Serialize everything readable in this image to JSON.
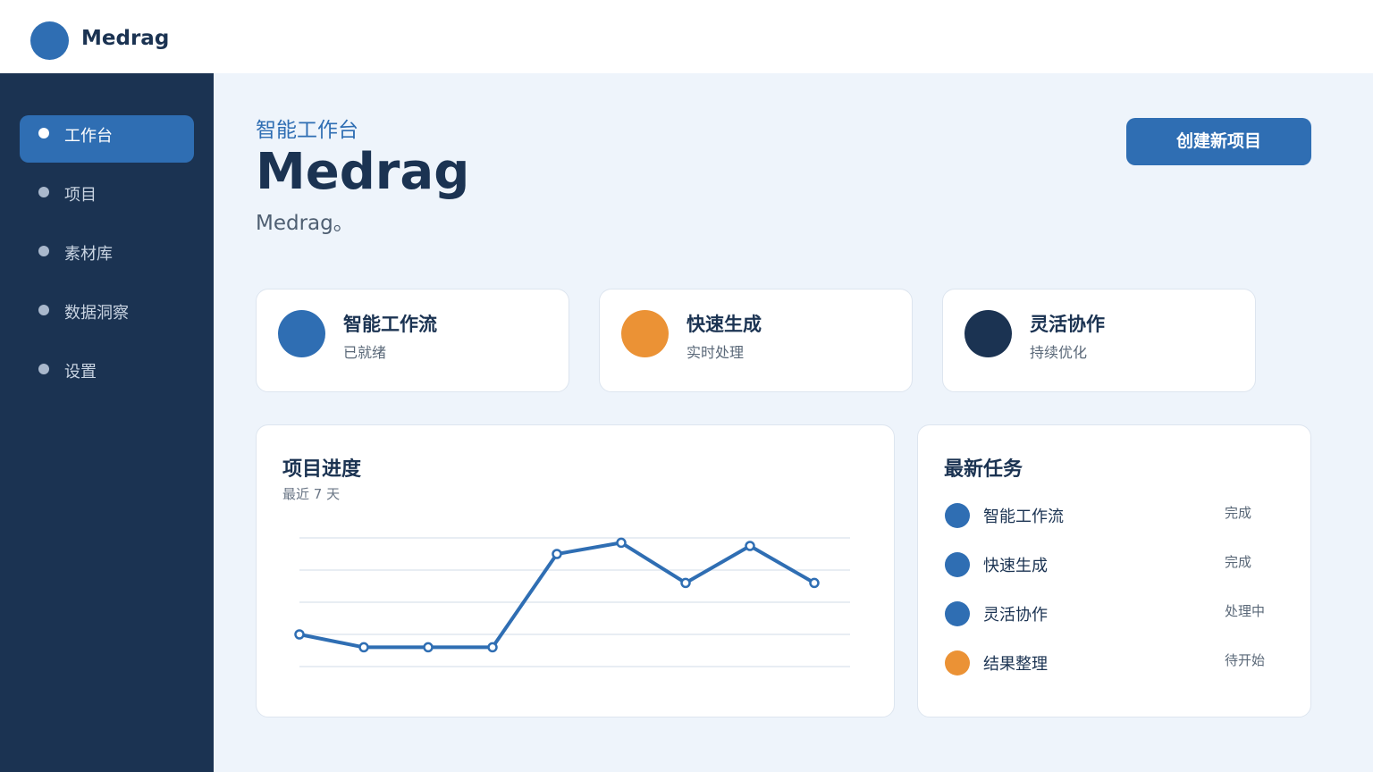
{
  "header": {
    "brand": "Medrag"
  },
  "sidebar": {
    "items": [
      {
        "label": "工作台",
        "active": true
      },
      {
        "label": "项目",
        "active": false
      },
      {
        "label": "素材库",
        "active": false
      },
      {
        "label": "数据洞察",
        "active": false
      },
      {
        "label": "设置",
        "active": false
      }
    ]
  },
  "main": {
    "subtitle": "智能工作台",
    "title": "Medrag",
    "description": "Medrag。",
    "create_button": "创建新项目"
  },
  "stats": [
    {
      "title": "智能工作流",
      "sub": "已就绪",
      "color": "#2f6eb3"
    },
    {
      "title": "快速生成",
      "sub": "实时处理",
      "color": "#eb9235"
    },
    {
      "title": "灵活协作",
      "sub": "持续优化",
      "color": "#1b3352"
    }
  ],
  "progress": {
    "title": "项目进度",
    "subtitle": "最近 7 天"
  },
  "chart_data": {
    "type": "line",
    "x": [
      1,
      2,
      3,
      4,
      5,
      6,
      7,
      8,
      9
    ],
    "values": [
      10,
      6,
      6,
      6,
      35,
      38.5,
      26,
      37.5,
      26
    ],
    "ylim": [
      0,
      40
    ],
    "grid": true,
    "color": "#2f6eb3"
  },
  "tasks": {
    "title": "最新任务",
    "items": [
      {
        "name": "智能工作流",
        "status": "完成",
        "color": "#2f6eb3"
      },
      {
        "name": "快速生成",
        "status": "完成",
        "color": "#2f6eb3"
      },
      {
        "name": "灵活协作",
        "status": "处理中",
        "color": "#2f6eb3"
      },
      {
        "name": "结果整理",
        "status": "待开始",
        "color": "#eb9235"
      }
    ]
  },
  "colors": {
    "accent": "#2f6eb3",
    "orange": "#eb9235",
    "navy": "#1b3352"
  }
}
